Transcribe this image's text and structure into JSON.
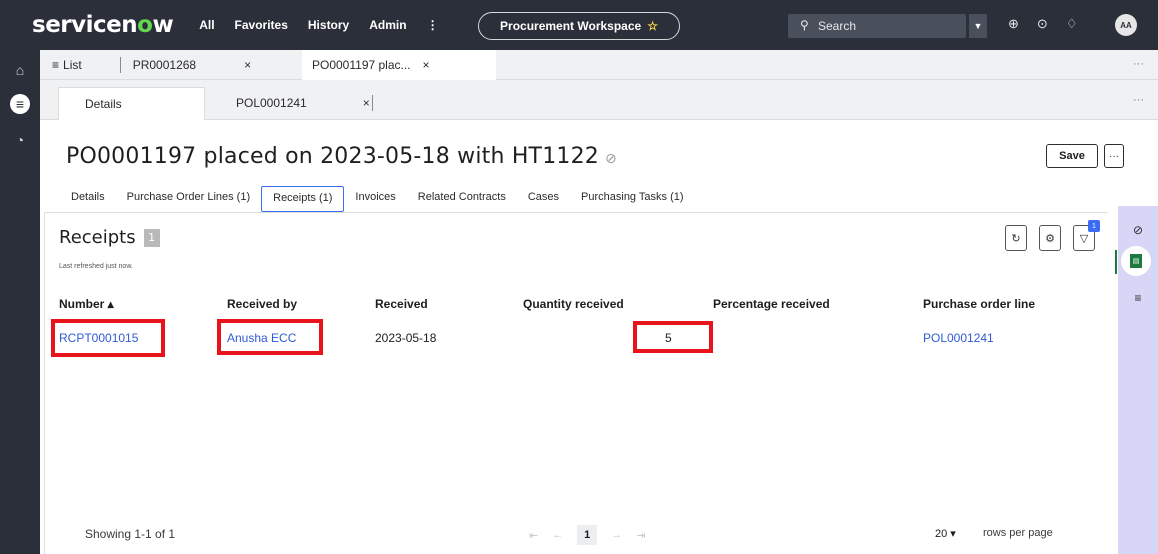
{
  "nav": {
    "logo_main": "servicen",
    "logo_o": "o",
    "logo_end": "w",
    "links": [
      "All",
      "Favorites",
      "History",
      "Admin",
      "⋮"
    ],
    "workspace": "Procurement Workspace",
    "search_placeholder": "Search",
    "avatar_initials": "AA"
  },
  "tabs_primary": {
    "list_label": "List",
    "tab1": "PR0001268",
    "tab2": "PO0001197 plac...",
    "close": "×",
    "more": "···"
  },
  "tabs_secondary": {
    "details": "Details",
    "pol": "POL0001241",
    "close": "×"
  },
  "record": {
    "title": "PO0001197 placed on 2023-05-18 with HT1122",
    "save_label": "Save",
    "more_label": "···"
  },
  "subtabs": [
    "Details",
    "Purchase Order Lines (1)",
    "Receipts (1)",
    "Invoices",
    "Related Contracts",
    "Cases",
    "Purchasing Tasks (1)"
  ],
  "subtabs_active_index": 2,
  "receipts": {
    "title": "Receipts",
    "count": "1",
    "last_refreshed": "Last refreshed just now.",
    "filter_count": "1",
    "columns": [
      "Number ▴",
      "Received by",
      "Received",
      "Quantity received",
      "Percentage received",
      "Purchase order line"
    ],
    "row": {
      "number": "RCPT0001015",
      "received_by": "Anusha ECC",
      "received": "2023-05-18",
      "quantity": "5",
      "percentage": "",
      "po_line": "POL0001241"
    },
    "showing": "Showing 1-1 of 1",
    "page": "1",
    "rows_per_page_value": "20 ▾",
    "rows_per_page_label": "rows per page"
  },
  "colors": {
    "nav_bg": "#2a2f3a",
    "logo_accent": "#62d84e",
    "link": "#2f5bd6",
    "highlight": "#e8131b",
    "sidebar_bg": "#d8d6f7"
  }
}
